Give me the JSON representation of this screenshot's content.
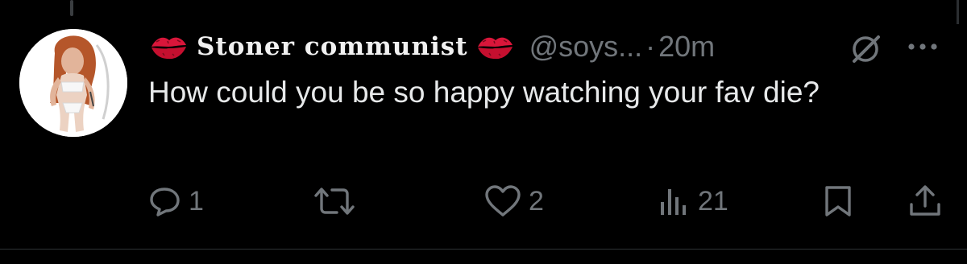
{
  "tweet": {
    "author": {
      "display_name": "Stoner communist",
      "handle": "@soys...",
      "separator": "·",
      "time": "20m"
    },
    "text": "How could you be so happy watching your fav die?",
    "stats": {
      "replies": "1",
      "likes": "2",
      "views": "21"
    }
  },
  "icons": {
    "name_emoji": "kiss-mark-icon",
    "grok": "grok-icon",
    "more": "more-options-icon",
    "reply": "reply-icon",
    "retweet": "retweet-icon",
    "like": "like-icon",
    "views": "views-icon",
    "bookmark": "bookmark-icon",
    "share": "share-icon"
  },
  "colors": {
    "background": "#000000",
    "text": "#e7e9ea",
    "secondary": "#71767b",
    "kiss": "#d9163a"
  }
}
